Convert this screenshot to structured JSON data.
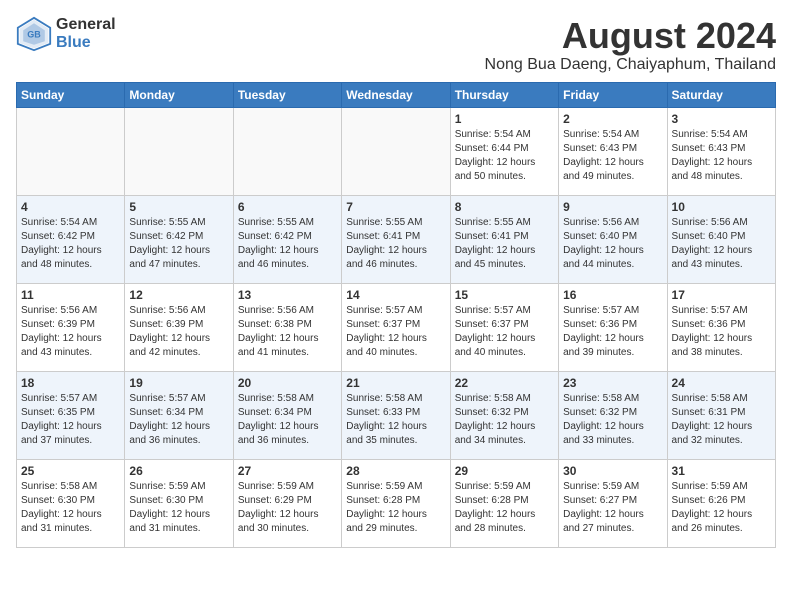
{
  "header": {
    "logo_line1": "General",
    "logo_line2": "Blue",
    "title": "August 2024",
    "subtitle": "Nong Bua Daeng, Chaiyaphum, Thailand"
  },
  "days_of_week": [
    "Sunday",
    "Monday",
    "Tuesday",
    "Wednesday",
    "Thursday",
    "Friday",
    "Saturday"
  ],
  "weeks": [
    [
      {
        "day": "",
        "info": ""
      },
      {
        "day": "",
        "info": ""
      },
      {
        "day": "",
        "info": ""
      },
      {
        "day": "",
        "info": ""
      },
      {
        "day": "1",
        "info": "Sunrise: 5:54 AM\nSunset: 6:44 PM\nDaylight: 12 hours\nand 50 minutes."
      },
      {
        "day": "2",
        "info": "Sunrise: 5:54 AM\nSunset: 6:43 PM\nDaylight: 12 hours\nand 49 minutes."
      },
      {
        "day": "3",
        "info": "Sunrise: 5:54 AM\nSunset: 6:43 PM\nDaylight: 12 hours\nand 48 minutes."
      }
    ],
    [
      {
        "day": "4",
        "info": "Sunrise: 5:54 AM\nSunset: 6:42 PM\nDaylight: 12 hours\nand 48 minutes."
      },
      {
        "day": "5",
        "info": "Sunrise: 5:55 AM\nSunset: 6:42 PM\nDaylight: 12 hours\nand 47 minutes."
      },
      {
        "day": "6",
        "info": "Sunrise: 5:55 AM\nSunset: 6:42 PM\nDaylight: 12 hours\nand 46 minutes."
      },
      {
        "day": "7",
        "info": "Sunrise: 5:55 AM\nSunset: 6:41 PM\nDaylight: 12 hours\nand 46 minutes."
      },
      {
        "day": "8",
        "info": "Sunrise: 5:55 AM\nSunset: 6:41 PM\nDaylight: 12 hours\nand 45 minutes."
      },
      {
        "day": "9",
        "info": "Sunrise: 5:56 AM\nSunset: 6:40 PM\nDaylight: 12 hours\nand 44 minutes."
      },
      {
        "day": "10",
        "info": "Sunrise: 5:56 AM\nSunset: 6:40 PM\nDaylight: 12 hours\nand 43 minutes."
      }
    ],
    [
      {
        "day": "11",
        "info": "Sunrise: 5:56 AM\nSunset: 6:39 PM\nDaylight: 12 hours\nand 43 minutes."
      },
      {
        "day": "12",
        "info": "Sunrise: 5:56 AM\nSunset: 6:39 PM\nDaylight: 12 hours\nand 42 minutes."
      },
      {
        "day": "13",
        "info": "Sunrise: 5:56 AM\nSunset: 6:38 PM\nDaylight: 12 hours\nand 41 minutes."
      },
      {
        "day": "14",
        "info": "Sunrise: 5:57 AM\nSunset: 6:37 PM\nDaylight: 12 hours\nand 40 minutes."
      },
      {
        "day": "15",
        "info": "Sunrise: 5:57 AM\nSunset: 6:37 PM\nDaylight: 12 hours\nand 40 minutes."
      },
      {
        "day": "16",
        "info": "Sunrise: 5:57 AM\nSunset: 6:36 PM\nDaylight: 12 hours\nand 39 minutes."
      },
      {
        "day": "17",
        "info": "Sunrise: 5:57 AM\nSunset: 6:36 PM\nDaylight: 12 hours\nand 38 minutes."
      }
    ],
    [
      {
        "day": "18",
        "info": "Sunrise: 5:57 AM\nSunset: 6:35 PM\nDaylight: 12 hours\nand 37 minutes."
      },
      {
        "day": "19",
        "info": "Sunrise: 5:57 AM\nSunset: 6:34 PM\nDaylight: 12 hours\nand 36 minutes."
      },
      {
        "day": "20",
        "info": "Sunrise: 5:58 AM\nSunset: 6:34 PM\nDaylight: 12 hours\nand 36 minutes."
      },
      {
        "day": "21",
        "info": "Sunrise: 5:58 AM\nSunset: 6:33 PM\nDaylight: 12 hours\nand 35 minutes."
      },
      {
        "day": "22",
        "info": "Sunrise: 5:58 AM\nSunset: 6:32 PM\nDaylight: 12 hours\nand 34 minutes."
      },
      {
        "day": "23",
        "info": "Sunrise: 5:58 AM\nSunset: 6:32 PM\nDaylight: 12 hours\nand 33 minutes."
      },
      {
        "day": "24",
        "info": "Sunrise: 5:58 AM\nSunset: 6:31 PM\nDaylight: 12 hours\nand 32 minutes."
      }
    ],
    [
      {
        "day": "25",
        "info": "Sunrise: 5:58 AM\nSunset: 6:30 PM\nDaylight: 12 hours\nand 31 minutes."
      },
      {
        "day": "26",
        "info": "Sunrise: 5:59 AM\nSunset: 6:30 PM\nDaylight: 12 hours\nand 31 minutes."
      },
      {
        "day": "27",
        "info": "Sunrise: 5:59 AM\nSunset: 6:29 PM\nDaylight: 12 hours\nand 30 minutes."
      },
      {
        "day": "28",
        "info": "Sunrise: 5:59 AM\nSunset: 6:28 PM\nDaylight: 12 hours\nand 29 minutes."
      },
      {
        "day": "29",
        "info": "Sunrise: 5:59 AM\nSunset: 6:28 PM\nDaylight: 12 hours\nand 28 minutes."
      },
      {
        "day": "30",
        "info": "Sunrise: 5:59 AM\nSunset: 6:27 PM\nDaylight: 12 hours\nand 27 minutes."
      },
      {
        "day": "31",
        "info": "Sunrise: 5:59 AM\nSunset: 6:26 PM\nDaylight: 12 hours\nand 26 minutes."
      }
    ]
  ]
}
